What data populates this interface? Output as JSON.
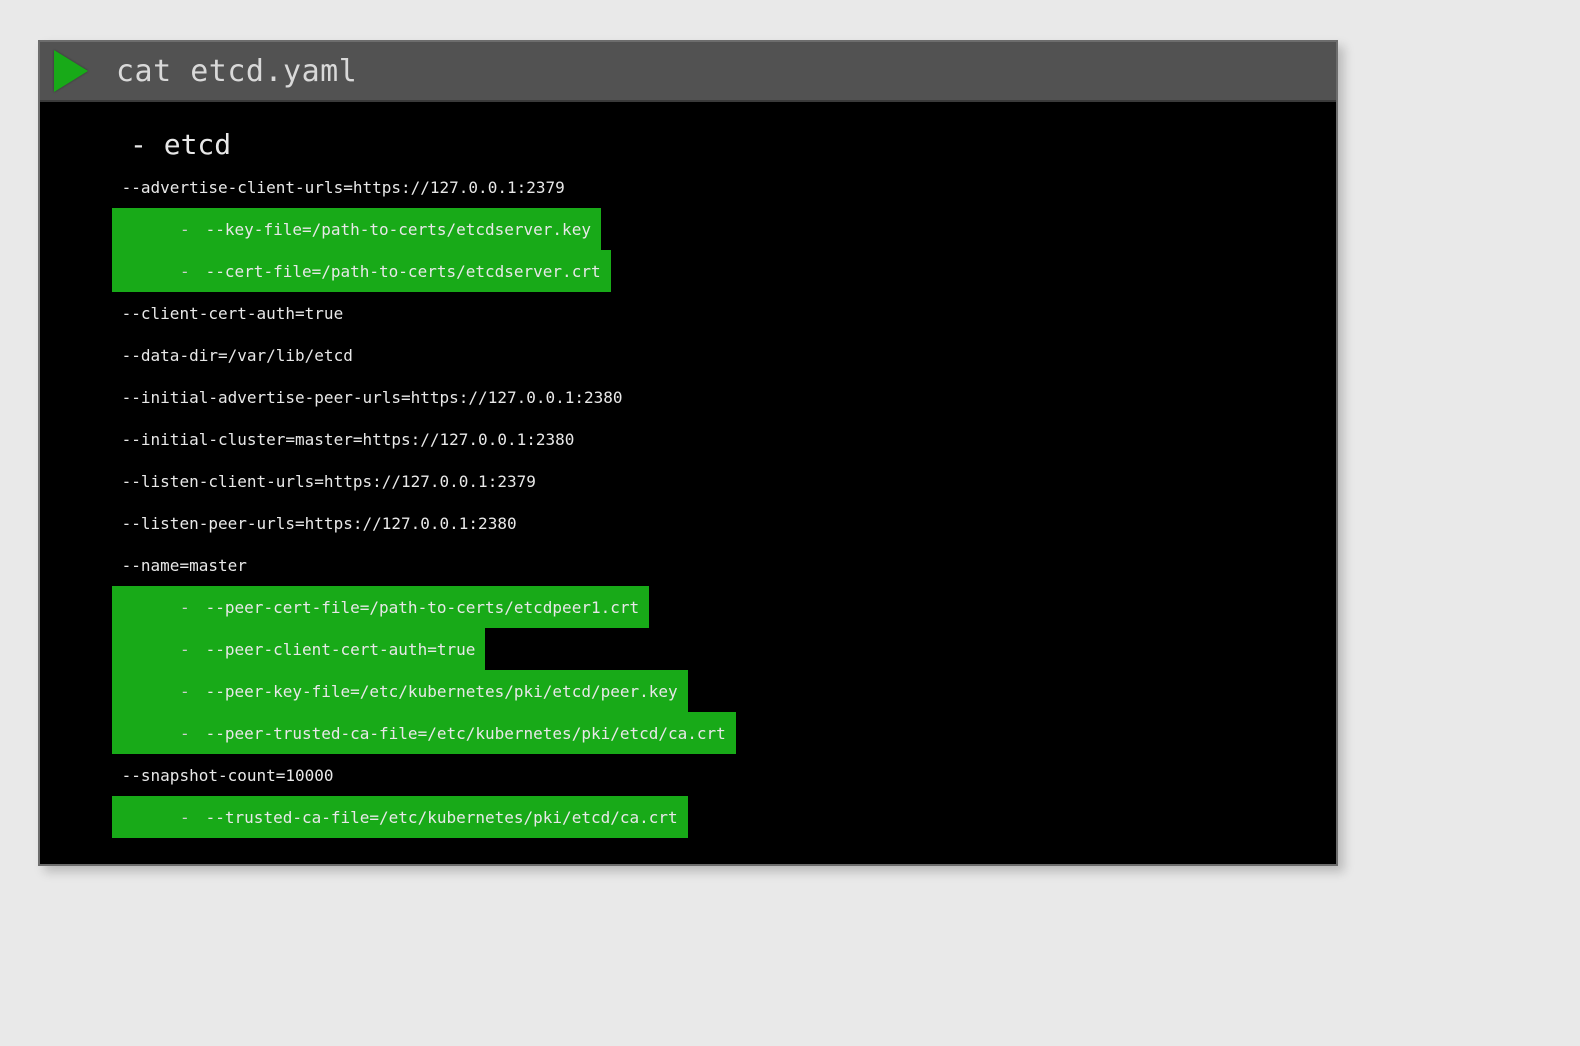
{
  "header": {
    "command": "cat etcd.yaml"
  },
  "yaml": {
    "root_bullet": "-",
    "root_name": "etcd",
    "lines": [
      {
        "highlight": false,
        "text": "--advertise-client-urls=https://127.0.0.1:2379"
      },
      {
        "highlight": true,
        "text": "--key-file=/path-to-certs/etcdserver.key"
      },
      {
        "highlight": true,
        "text": "--cert-file=/path-to-certs/etcdserver.crt"
      },
      {
        "highlight": false,
        "text": "--client-cert-auth=true"
      },
      {
        "highlight": false,
        "text": "--data-dir=/var/lib/etcd"
      },
      {
        "highlight": false,
        "text": "--initial-advertise-peer-urls=https://127.0.0.1:2380"
      },
      {
        "highlight": false,
        "text": "--initial-cluster=master=https://127.0.0.1:2380"
      },
      {
        "highlight": false,
        "text": "--listen-client-urls=https://127.0.0.1:2379"
      },
      {
        "highlight": false,
        "text": "--listen-peer-urls=https://127.0.0.1:2380"
      },
      {
        "highlight": false,
        "text": "--name=master"
      },
      {
        "highlight": true,
        "text": "--peer-cert-file=/path-to-certs/etcdpeer1.crt"
      },
      {
        "highlight": true,
        "text": "--peer-client-cert-auth=true"
      },
      {
        "highlight": true,
        "text": "--peer-key-file=/etc/kubernetes/pki/etcd/peer.key"
      },
      {
        "highlight": true,
        "text": "--peer-trusted-ca-file=/etc/kubernetes/pki/etcd/ca.crt"
      },
      {
        "highlight": false,
        "text": "--snapshot-count=10000"
      },
      {
        "highlight": true,
        "text": "--trusted-ca-file=/etc/kubernetes/pki/etcd/ca.crt"
      }
    ]
  },
  "bullet": "-"
}
